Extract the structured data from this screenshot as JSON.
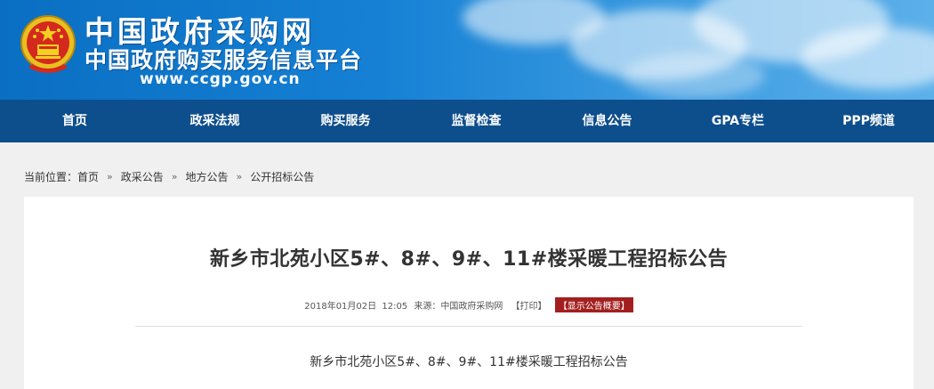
{
  "header": {
    "site_name": "中国政府采购网",
    "site_subtitle": "中国政府购买服务信息平台",
    "url": "www.ccgp.gov.cn"
  },
  "nav": {
    "items": [
      "首页",
      "政采法规",
      "购买服务",
      "监督检查",
      "信息公告",
      "GPA专栏",
      "PPP频道"
    ]
  },
  "breadcrumb": {
    "label": "当前位置：",
    "items": [
      "首页",
      "政采公告",
      "地方公告",
      "公开招标公告"
    ],
    "separator": "»"
  },
  "article": {
    "title": "新乡市北苑小区5#、8#、9#、11#楼采暖工程招标公告",
    "date": "2018年01月02日",
    "time": "12:05",
    "source_label": "来源：",
    "source": "中国政府采购网",
    "print_label": "【打印】",
    "summary_label": "【显示公告概要】",
    "subtitle": "新乡市北苑小区5#、8#、9#、11#楼采暖工程招标公告"
  },
  "colors": {
    "nav_bg": "#0d4e8c",
    "banner_bg": "#1580d4",
    "summary_badge": "#a31f1f"
  }
}
